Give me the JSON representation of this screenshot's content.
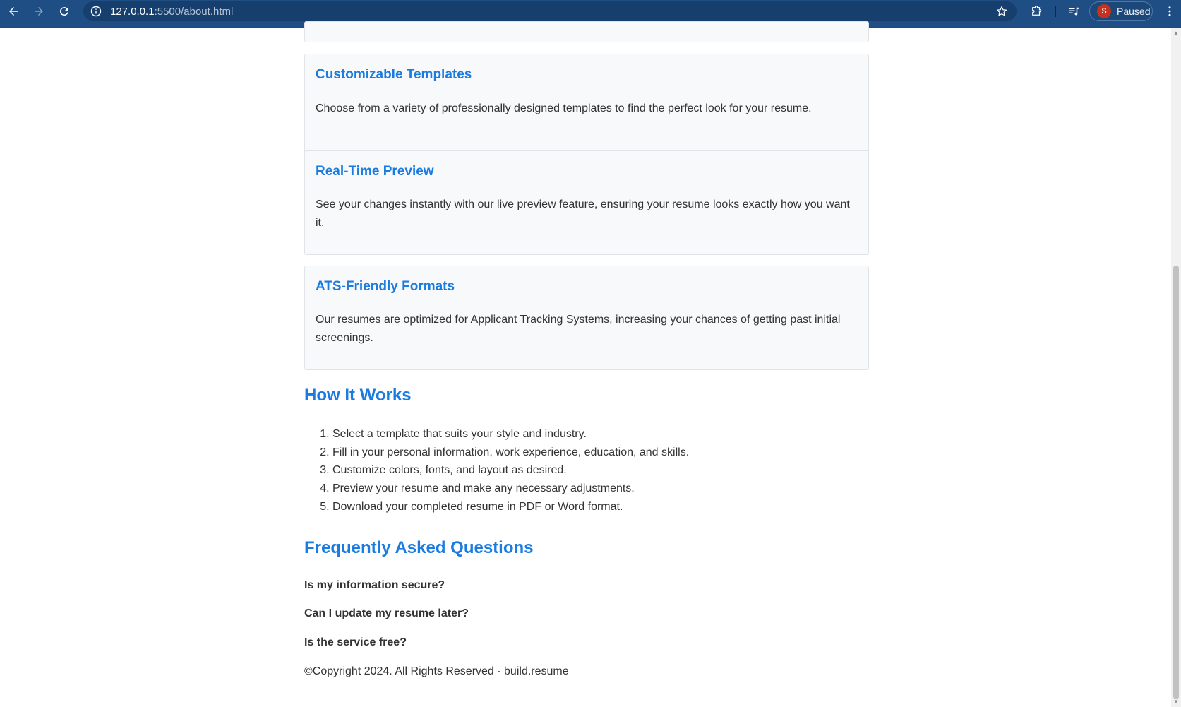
{
  "browser": {
    "url_host": "127.0.0.1",
    "url_path": ":5500/about.html",
    "profile_initial": "S",
    "profile_status": "Paused"
  },
  "features": [
    {
      "title": "Customizable Templates",
      "text": "Choose from a variety of professionally designed templates to find the perfect look for your resume."
    },
    {
      "title": "Real-Time Preview",
      "text": "See your changes instantly with our live preview feature, ensuring your resume looks exactly how you want it."
    },
    {
      "title": "ATS-Friendly Formats",
      "text": "Our resumes are optimized for Applicant Tracking Systems, increasing your chances of getting past initial screenings."
    }
  ],
  "how_it_works": {
    "title": "How It Works",
    "steps": [
      "Select a template that suits your style and industry.",
      "Fill in your personal information, work experience, education, and skills.",
      "Customize colors, fonts, and layout as desired.",
      "Preview your resume and make any necessary adjustments.",
      "Download your completed resume in PDF or Word format."
    ]
  },
  "faq": {
    "title": "Frequently Asked Questions",
    "questions": [
      "Is my information secure?",
      "Can I update my resume later?",
      "Is the service free?"
    ]
  },
  "footer": {
    "copyright": "©Copyright 2024. All Rights Reserved - build.resume"
  },
  "colors": {
    "accent": "#1a7be0",
    "chrome": "#1f4e85",
    "card_bg": "#f8f9fa"
  }
}
